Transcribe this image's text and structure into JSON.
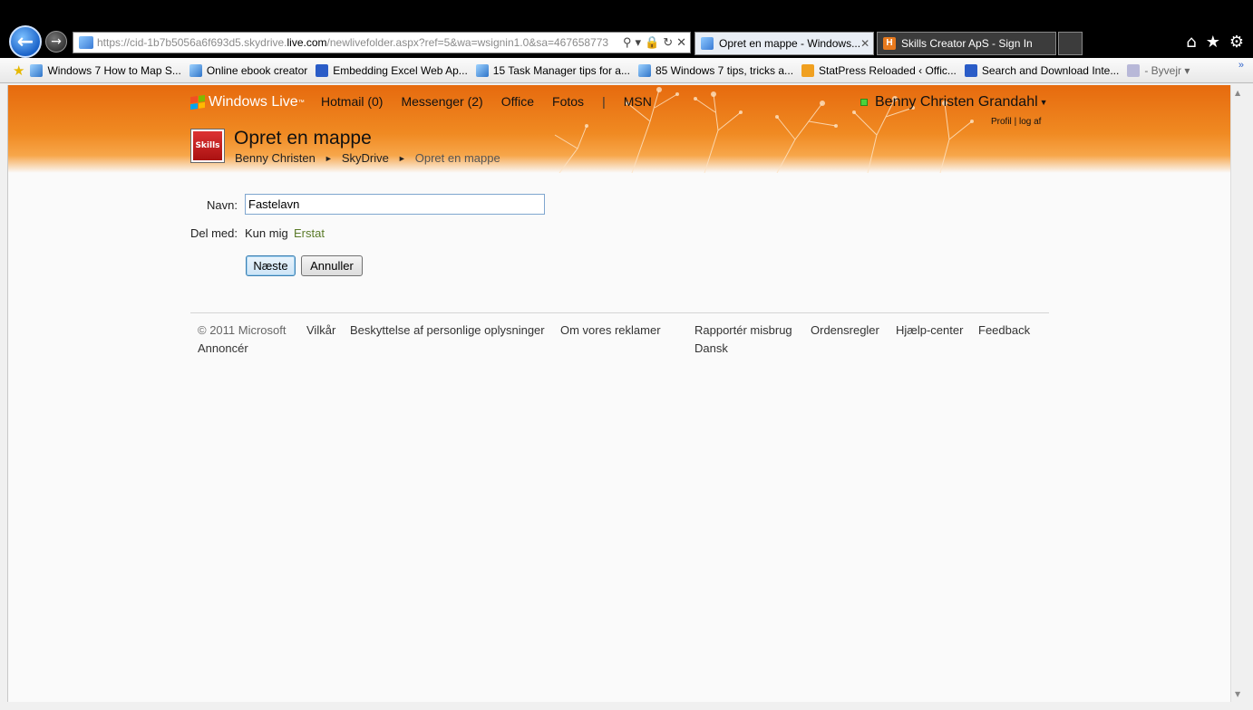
{
  "browser": {
    "url": {
      "prefix": "https://",
      "before_host": "cid-1b7b5056a6f693d5.skydrive.",
      "host": "live.com",
      "after_host": "/newlivefolder.aspx?ref=5&wa=wsignin1.0&sa=467658773"
    },
    "tabs": [
      {
        "title": "Opret en mappe - Windows...",
        "active": true
      },
      {
        "title": "Skills Creator ApS - Sign In",
        "active": false,
        "icon_text": "H"
      }
    ],
    "favorites": [
      {
        "label": "Windows 7 How to Map S...",
        "icon": "ie-page-icon"
      },
      {
        "label": "Online ebook creator",
        "icon": "ie-page-icon"
      },
      {
        "label": "Embedding Excel Web Ap...",
        "icon": "feather-icon"
      },
      {
        "label": "15 Task Manager tips for a...",
        "icon": "ie-page-icon"
      },
      {
        "label": "85 Windows 7 tips, tricks a...",
        "icon": "ie-page-icon"
      },
      {
        "label": "StatPress Reloaded ‹ Offic...",
        "icon": "statpress-icon"
      },
      {
        "label": "Search and Download Inte...",
        "icon": "msn-icon"
      },
      {
        "label": "- Byvejr",
        "icon": "crown-icon"
      }
    ]
  },
  "header": {
    "brand": "Windows Live",
    "brand_tm": "™",
    "nav": [
      "Hotmail (0)",
      "Messenger (2)",
      "Office",
      "Fotos",
      "MSN"
    ],
    "nav_separator": "|",
    "user_name": "Benny Christen Grandahl",
    "user_links": {
      "profile": "Profil",
      "sep": "|",
      "logout": "log af"
    },
    "folder_thumb_text": "Skills",
    "page_title": "Opret en mappe",
    "breadcrumb": [
      "Benny Christen",
      "SkyDrive",
      "Opret en mappe"
    ],
    "breadcrumb_arrow": "►"
  },
  "form": {
    "name_label": "Navn:",
    "name_value": "Fastelavn",
    "share_label": "Del med:",
    "share_value": "Kun mig",
    "share_change": "Erstat",
    "next_button": "Næste",
    "cancel_button": "Annuller"
  },
  "footer": {
    "copyright": "© 2011 Microsoft",
    "left_links": [
      "Vilkår",
      "Beskyttelse af personlige oplysninger",
      "Om vores reklamer",
      "Annoncér"
    ],
    "right_links": [
      "Rapportér misbrug",
      "Ordensregler",
      "Hjælp-center",
      "Feedback",
      "Dansk"
    ]
  },
  "colors": {
    "header_orange": "#e66a0e",
    "link_green": "#5a7a28",
    "input_border": "#7fa6cf"
  }
}
